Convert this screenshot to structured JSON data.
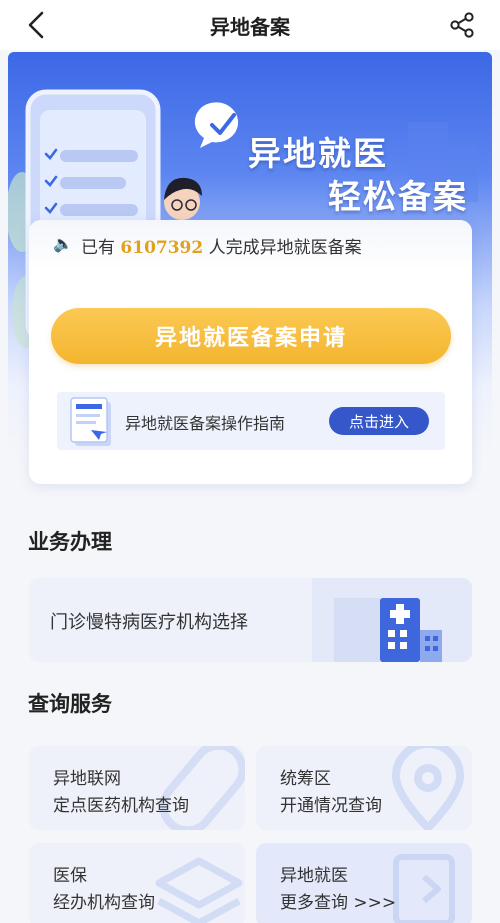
{
  "header": {
    "title": "异地备案"
  },
  "banner": {
    "slogan_line1": "异地就医",
    "slogan_line2": "轻松备案"
  },
  "notice": {
    "prefix": "已有",
    "count": "6107392",
    "suffix": "人完成异地就医备案"
  },
  "main": {
    "apply_label": "异地就医备案申请",
    "guide_label": "异地就医备案操作指南",
    "guide_button": "点击进入"
  },
  "business": {
    "title": "业务办理",
    "items": [
      {
        "label": "门诊慢特病医疗机构选择"
      }
    ]
  },
  "query": {
    "title": "查询服务",
    "items": [
      {
        "line1": "异地联网",
        "line2": "定点医药机构查询"
      },
      {
        "line1": "统筹区",
        "line2": "开通情况查询"
      },
      {
        "line1": "医保",
        "line2": "经办机构查询"
      },
      {
        "line1": "异地就医",
        "line2": "更多查询 >>>"
      }
    ]
  },
  "colors": {
    "primary_blue": "#3657c9",
    "accent_yellow": "#f4b52f",
    "banner_blue": "#3c68e6"
  }
}
